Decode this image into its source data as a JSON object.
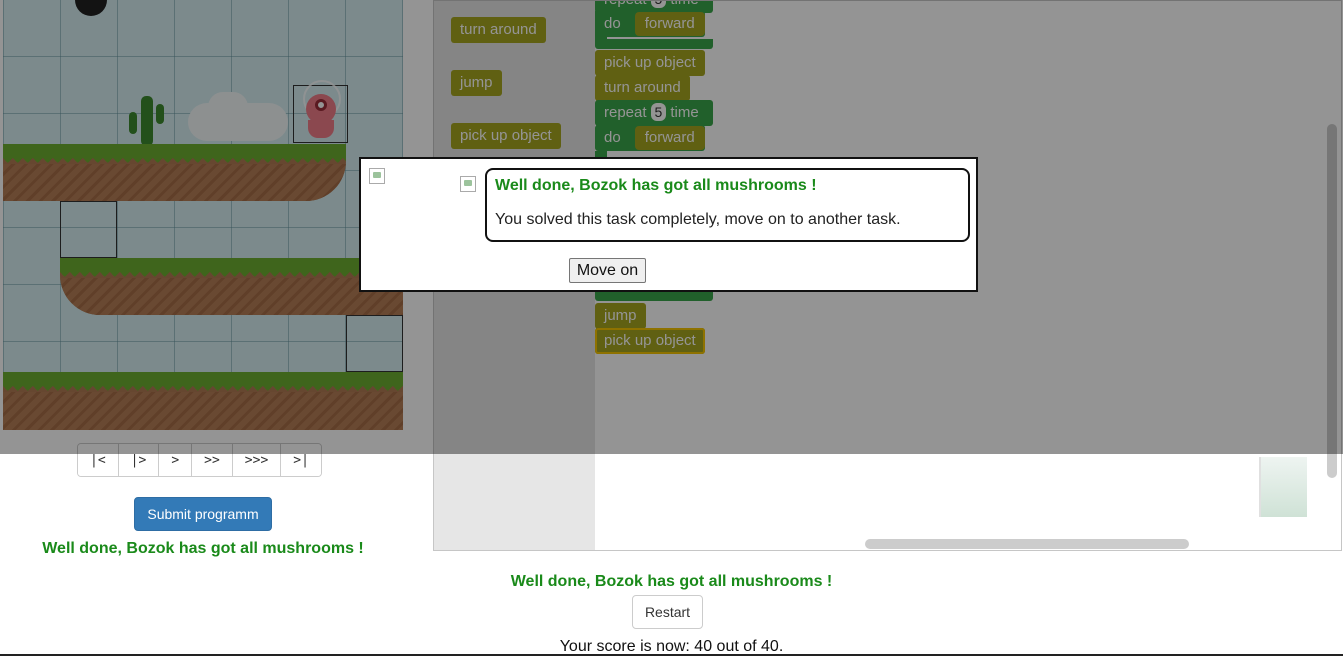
{
  "game": {
    "controls": [
      "|<",
      "|>",
      ">",
      ">>",
      ">>>",
      ">|"
    ]
  },
  "submit_label": "Submit programm",
  "left_status": "Well done, Bozok has got all mushrooms !",
  "workspace": {
    "toolbox": [
      "turn around",
      "jump",
      "pick up object"
    ],
    "program": {
      "repeat_word": "repeat",
      "time_word": "time",
      "do_word": "do",
      "repeat_1_count": "5",
      "repeat_1_body": "forward",
      "line_2": "pick up object",
      "line_3": "turn around",
      "repeat_2_count": "5",
      "repeat_2_body": "forward",
      "line_after_1": "jump",
      "line_after_2": "pick up object"
    }
  },
  "bottom_status": "Well done, Bozok has got all mushrooms !",
  "restart_label": "Restart",
  "score_text": "Your score is now: 40 out of 40.",
  "modal": {
    "title": "Well done, Bozok has got all mushrooms !",
    "message": "You solved this task completely, move on to another task.",
    "button": "Move on"
  },
  "colors": {
    "success_text": "#1a8a1a",
    "primary_button": "#337ab7",
    "move_block": "#a5a51f",
    "loop_block": "#3aa64a"
  }
}
